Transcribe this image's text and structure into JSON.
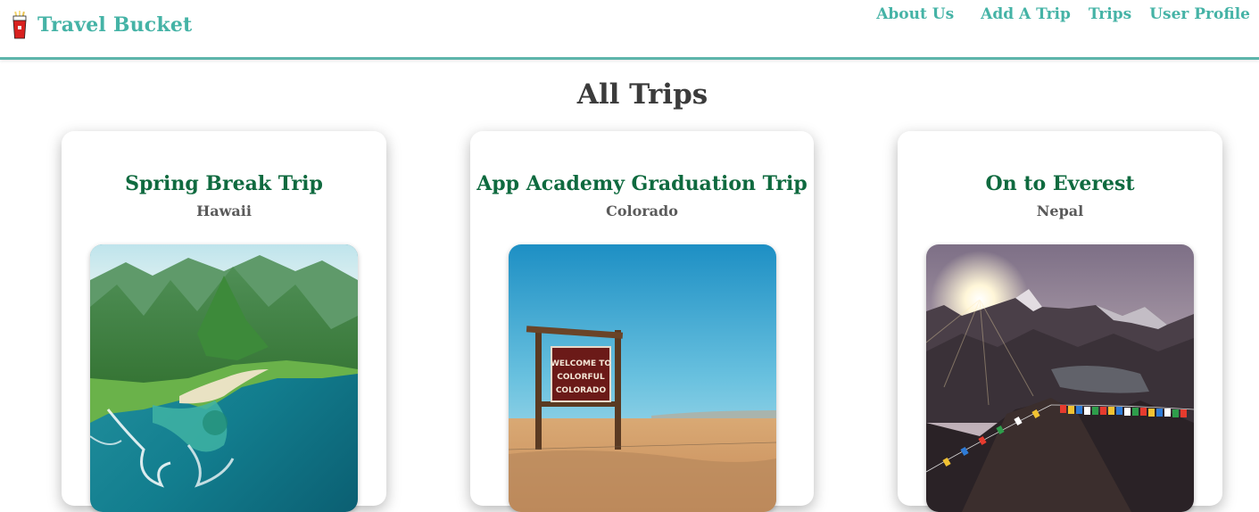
{
  "navbar": {
    "brand_name": "Travel Bucket",
    "links": [
      {
        "label": "About Us"
      },
      {
        "label": "Add A Trip"
      },
      {
        "label": "Trips"
      },
      {
        "label": "User Profile"
      }
    ],
    "accent_color": "#45b3a6"
  },
  "main": {
    "page_title": "All Trips",
    "trips": [
      {
        "title": "Spring Break Trip",
        "location": "Hawaii",
        "image_icon": "hawaii-coast-photo"
      },
      {
        "title": "App Academy Graduation Trip",
        "location": "Colorado",
        "image_icon": "colorado-sign-photo",
        "sign_text": [
          "WELCOME TO",
          "COLORFUL",
          "COLORADO"
        ]
      },
      {
        "title": "On to Everest",
        "location": "Nepal",
        "image_icon": "everest-mountains-photo"
      }
    ],
    "title_color": "#0f6a3f"
  }
}
